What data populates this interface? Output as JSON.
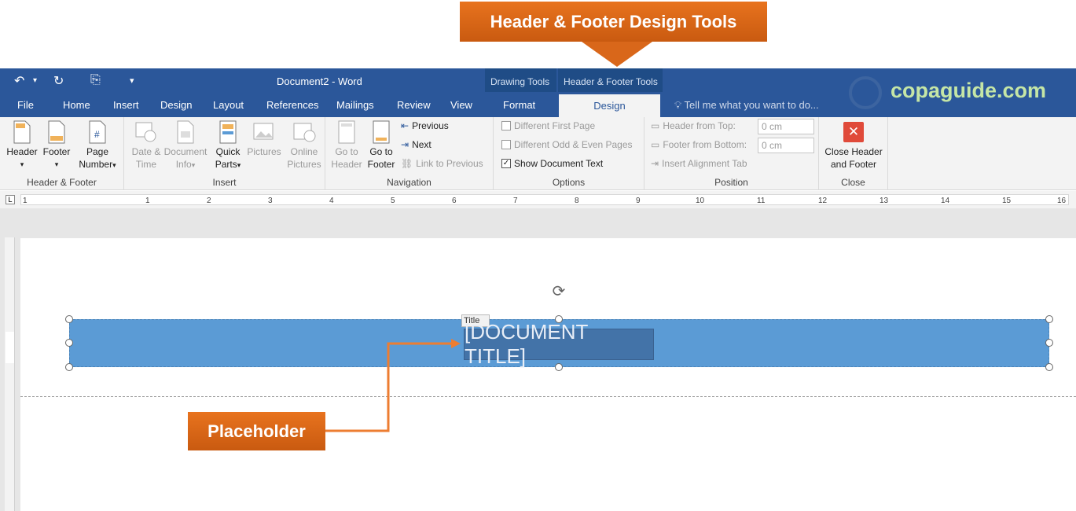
{
  "callouts": {
    "top": "Header & Footer Design Tools",
    "placeholder": "Placeholder"
  },
  "window": {
    "title": "Document2 - Word",
    "brand": "copaguide.com"
  },
  "context_groups": {
    "drawing_tools": "Drawing Tools",
    "hf_tools": "Header & Footer Tools"
  },
  "tabs": [
    {
      "label": "File"
    },
    {
      "label": "Home"
    },
    {
      "label": "Insert"
    },
    {
      "label": "Design"
    },
    {
      "label": "Layout"
    },
    {
      "label": "References"
    },
    {
      "label": "Mailings"
    },
    {
      "label": "Review"
    },
    {
      "label": "View"
    },
    {
      "label": "Format"
    },
    {
      "label": "Design"
    }
  ],
  "tellme": "Tell me what you want to do...",
  "ribbon": {
    "hf": {
      "label": "Header & Footer",
      "header": "Header",
      "footer": "Footer",
      "page_number_1": "Page",
      "page_number_2": "Number"
    },
    "insert": {
      "label": "Insert",
      "date_1": "Date &",
      "date_2": "Time",
      "docinfo_1": "Document",
      "docinfo_2": "Info",
      "quick_1": "Quick",
      "quick_2": "Parts",
      "pictures": "Pictures",
      "online_1": "Online",
      "online_2": "Pictures"
    },
    "navigation": {
      "label": "Navigation",
      "goto_header_1": "Go to",
      "goto_header_2": "Header",
      "goto_footer_1": "Go to",
      "goto_footer_2": "Footer",
      "previous": "Previous",
      "next": "Next",
      "link_previous": "Link to Previous"
    },
    "options": {
      "label": "Options",
      "diff_first": "Different First Page",
      "diff_odd": "Different Odd & Even Pages",
      "show_doc": "Show Document Text",
      "show_doc_checked": "✓"
    },
    "position": {
      "label": "Position",
      "header_top": "Header from Top:",
      "footer_bottom": "Footer from Bottom:",
      "header_val": "0 cm",
      "footer_val": "0 cm",
      "align_tab": "Insert Alignment Tab"
    },
    "close": {
      "label": "Close",
      "btn_1": "Close Header",
      "btn_2": "and Footer",
      "icon": "✕"
    }
  },
  "ruler": {
    "tab_marker": "L",
    "numbers": [
      "1",
      "1",
      "2",
      "3",
      "4",
      "5",
      "6",
      "7",
      "8",
      "9",
      "10",
      "11",
      "12",
      "13",
      "14",
      "15",
      "16"
    ]
  },
  "document": {
    "title_tag": "Title",
    "title_placeholder": "[DOCUMENT TITLE]"
  }
}
